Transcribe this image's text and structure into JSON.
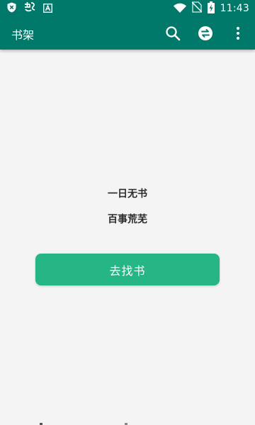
{
  "status_bar": {
    "time": "11:43",
    "icons": [
      "shield-x-icon",
      "signal-app-icon",
      "font-app-icon",
      "wifi-icon",
      "no-sim-icon",
      "battery-charging-icon"
    ]
  },
  "app_bar": {
    "title": "书架",
    "actions": [
      "search-icon",
      "swap-icon",
      "more-vert-icon"
    ]
  },
  "empty_state": {
    "line1": "一日无书",
    "line2": "百事荒芜",
    "button_label": "去找书"
  },
  "colors": {
    "primary": "#00796b",
    "button": "#26b585",
    "background": "#f4f4f4"
  }
}
